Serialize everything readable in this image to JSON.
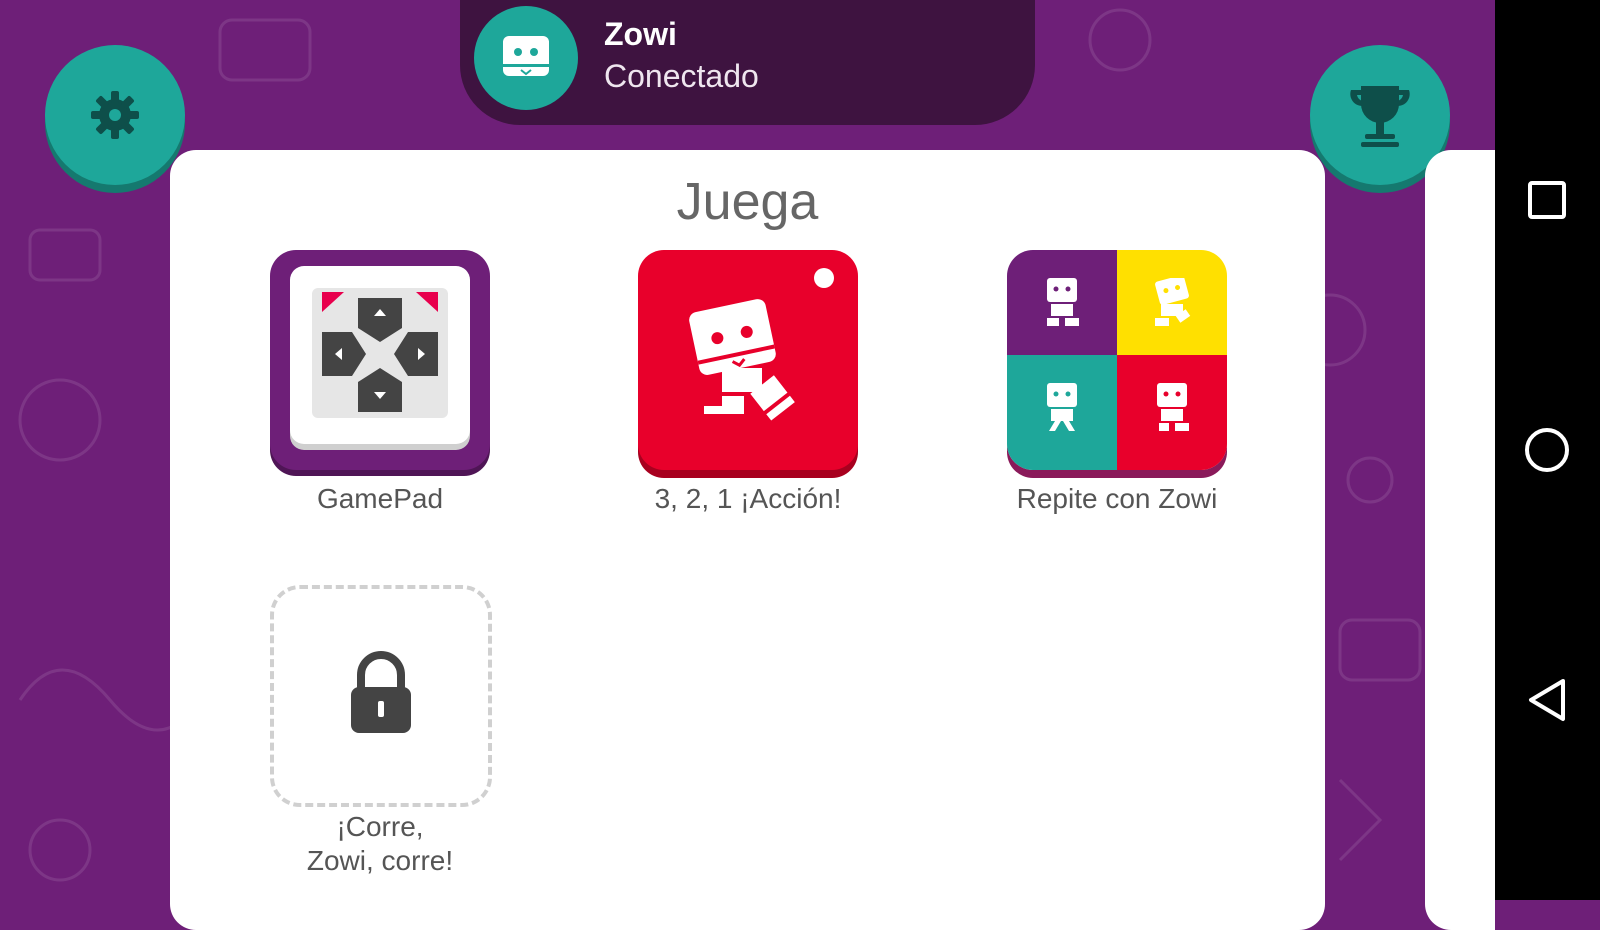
{
  "header": {
    "device_name": "Zowi",
    "status": "Conectado",
    "icon": "robot-face-icon"
  },
  "buttons": {
    "settings_icon": "gear-icon",
    "achievements_icon": "trophy-icon"
  },
  "section": {
    "title": "Juega"
  },
  "games": [
    {
      "label": "GamePad",
      "icon": "gamepad-icon",
      "locked": false
    },
    {
      "label": "3, 2, 1 ¡Acción!",
      "icon": "walking-robot-icon",
      "locked": false
    },
    {
      "label": "Repite con Zowi",
      "icon": "four-robots-icon",
      "locked": false
    },
    {
      "label": "¡Corre, Zowi, corre!",
      "icon": "lock-icon",
      "locked": true
    }
  ],
  "navbar": {
    "recents_icon": "square-icon",
    "home_icon": "circle-icon",
    "back_icon": "triangle-back-icon"
  },
  "colors": {
    "background": "#6e1f78",
    "header": "#3e1340",
    "teal": "#1ea79a",
    "red": "#e8002b",
    "yellow": "#ffe000"
  }
}
